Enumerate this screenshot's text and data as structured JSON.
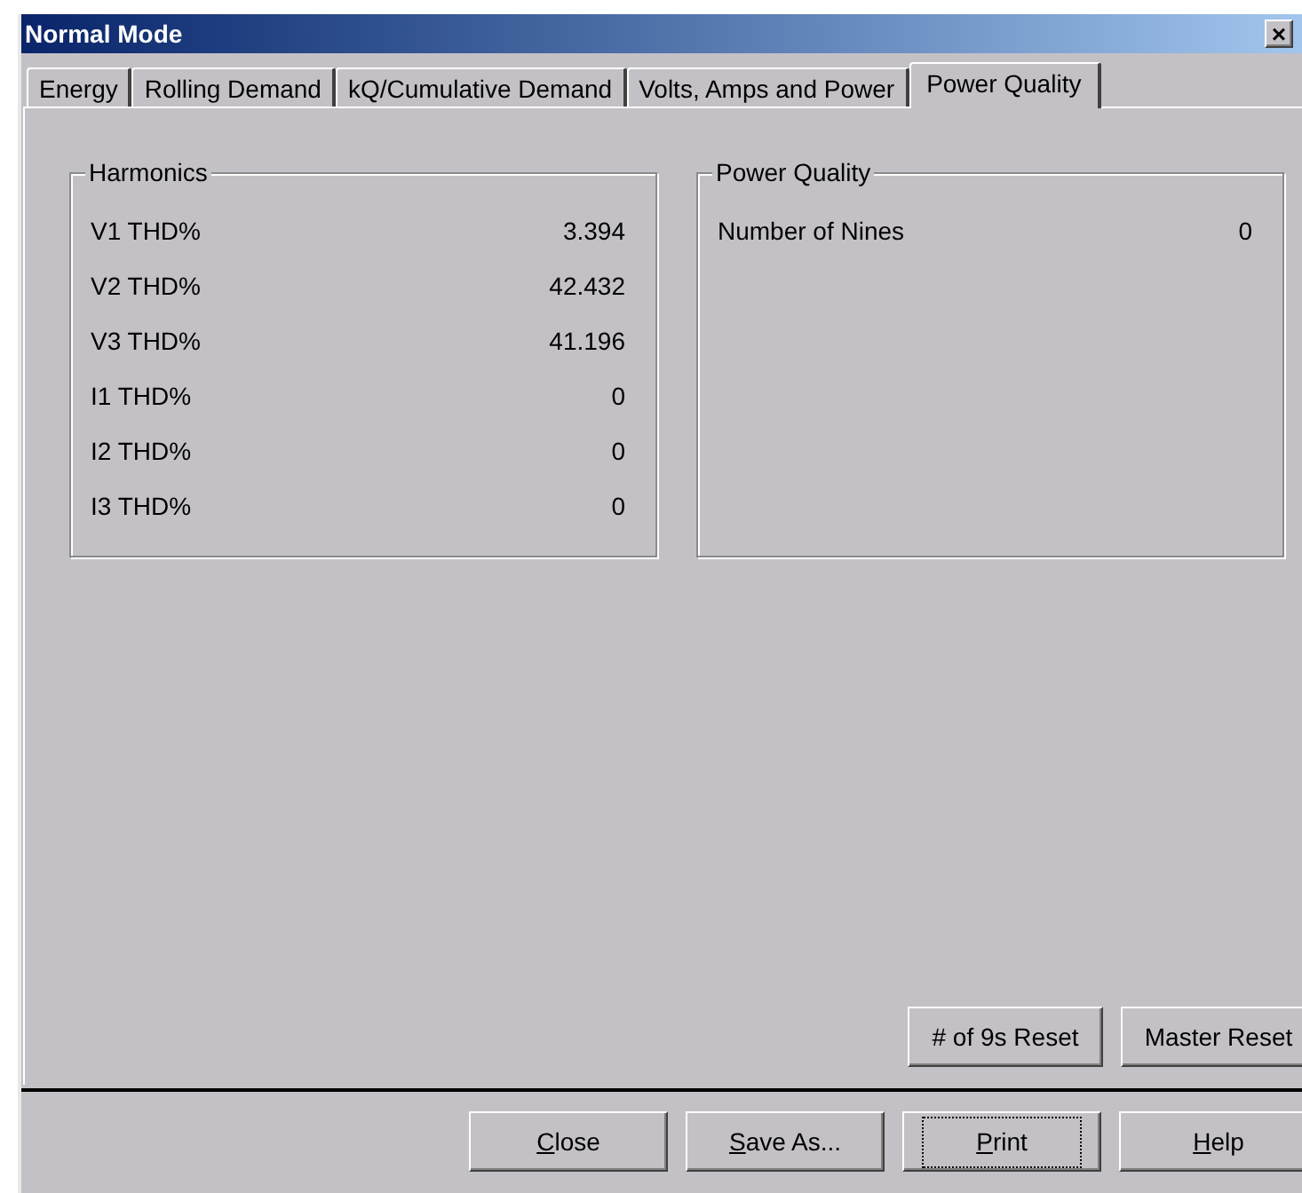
{
  "window": {
    "title": "Normal Mode",
    "close": "×"
  },
  "tabs": [
    {
      "label": "Energy",
      "selected": false
    },
    {
      "label": "Rolling Demand",
      "selected": false
    },
    {
      "label": "kQ/Cumulative Demand",
      "selected": false
    },
    {
      "label": "Volts, Amps and Power",
      "selected": false
    },
    {
      "label": "Power Quality",
      "selected": true
    }
  ],
  "harmonics": {
    "title": "Harmonics",
    "rows": [
      {
        "label": "V1 THD%",
        "value": "3.394"
      },
      {
        "label": "V2 THD%",
        "value": "42.432"
      },
      {
        "label": "V3 THD%",
        "value": "41.196"
      },
      {
        "label": "I1 THD%",
        "value": "0"
      },
      {
        "label": "I2 THD%",
        "value": "0"
      },
      {
        "label": "I3 THD%",
        "value": "0"
      }
    ]
  },
  "power_quality": {
    "title": "Power Quality",
    "rows": [
      {
        "label": "Number of Nines",
        "value": "0"
      }
    ]
  },
  "reset_buttons": [
    "# of 9s Reset",
    "Master Reset"
  ],
  "buttons": [
    {
      "label": "Close",
      "underline_first": true,
      "focused": false
    },
    {
      "label": "Save As...",
      "underline_first": true,
      "focused": false
    },
    {
      "label": "Print",
      "underline_first": true,
      "focused": true
    },
    {
      "label": "Help",
      "underline_first": true,
      "focused": false
    }
  ]
}
